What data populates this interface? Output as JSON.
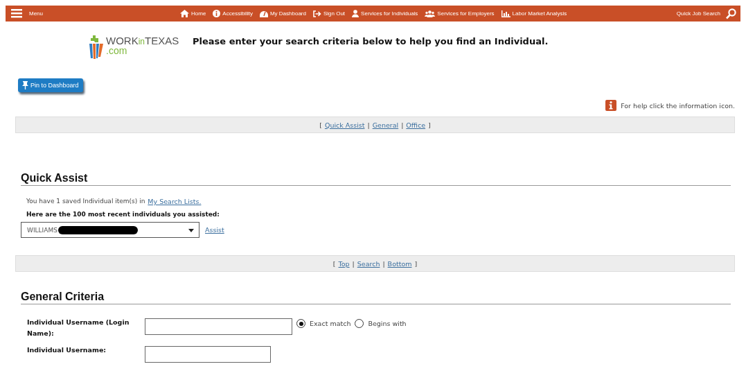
{
  "nav": {
    "menu": "Menu",
    "items": [
      {
        "label": "Home"
      },
      {
        "label": "Accessibility"
      },
      {
        "label": "My Dashboard"
      },
      {
        "label": "Sign Out"
      },
      {
        "label": "Services for Individuals"
      },
      {
        "label": "Services for Employers"
      },
      {
        "label": "Labor Market Analysis"
      }
    ],
    "quick_search": "Quick Job Search"
  },
  "logo": {
    "part_1": "WORK",
    "part_2": "in",
    "part_3": "TEXAS",
    "suffix": ".com"
  },
  "page_heading": "Please enter your search criteria below to help you find an Individual.",
  "pin_button": "Pin to Dashboard",
  "help_text": "For help click the information icon.",
  "jump_bars": [
    {
      "items": [
        {
          "kind": "text",
          "text": "["
        },
        {
          "kind": "link",
          "text": "Quick Assist"
        },
        {
          "kind": "text",
          "text": "|"
        },
        {
          "kind": "link",
          "text": "General"
        },
        {
          "kind": "text",
          "text": "|"
        },
        {
          "kind": "link",
          "text": "Office"
        },
        {
          "kind": "text",
          "text": "]"
        }
      ]
    },
    {
      "items": [
        {
          "kind": "text",
          "text": "["
        },
        {
          "kind": "link",
          "text": "Top"
        },
        {
          "kind": "text",
          "text": "|"
        },
        {
          "kind": "link",
          "text": "Search"
        },
        {
          "kind": "text",
          "text": "|"
        },
        {
          "kind": "link",
          "text": "Bottom"
        },
        {
          "kind": "text",
          "text": "]"
        }
      ]
    }
  ],
  "quick_assist": {
    "title": "Quick Assist",
    "saved_text": "You have 1 saved Individual item(s) in",
    "saved_link": "My Search Lists.",
    "recent_label": "Here are the 100 most recent individuals you assisted:",
    "select_value": "WILLIAMS",
    "redacted": true,
    "assist_link": "Assist"
  },
  "general": {
    "title": "General Criteria",
    "fields": [
      {
        "label": "Individual Username (Login Name):",
        "options": [
          {
            "label": "Exact match",
            "selected": true
          },
          {
            "label": "Begins with",
            "selected": false
          }
        ]
      },
      {
        "label": "Individual Username:"
      }
    ]
  }
}
